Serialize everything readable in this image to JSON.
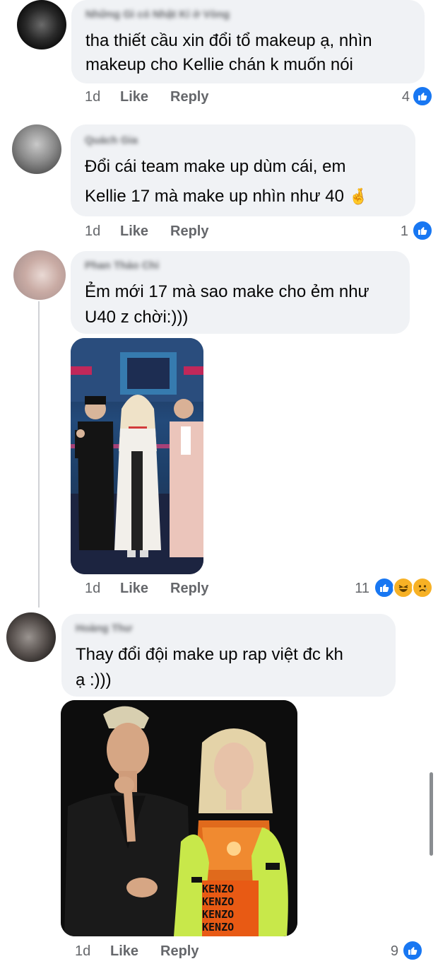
{
  "comments": [
    {
      "author": "Những Gì có Nhật Kí ở Vòng",
      "text_lines": [
        "tha thiết cầu xin đổi tổ makeup ạ, nhìn",
        "makeup cho Kellie chán k muốn nói"
      ],
      "time": "1d",
      "like_label": "Like",
      "reply_label": "Reply",
      "reaction_count": "4",
      "reactions": [
        "like-icon"
      ]
    },
    {
      "author": "Quách Gia",
      "text_lines": [
        "Đổi cái team make up dùm cái, em",
        "Kellie 17 mà make up nhìn như 40"
      ],
      "emoji": "🤞",
      "time": "1d",
      "like_label": "Like",
      "reply_label": "Reply",
      "reaction_count": "1",
      "reactions": [
        "like-icon"
      ]
    },
    {
      "author": "Phan Thảo Chi",
      "text_lines": [
        "Ẻm mới 17 mà sao make cho ẻm như",
        "U40 z chời:)))"
      ],
      "time": "1d",
      "like_label": "Like",
      "reply_label": "Reply",
      "reaction_count": "11",
      "reactions": [
        "like-icon",
        "laughing-face-icon",
        "sad-face-icon"
      ]
    },
    {
      "author": "Hoàng Thư",
      "text_lines": [
        "Thay đổi đội make up rap việt đc kh",
        "ạ :)))"
      ],
      "time": "1d",
      "like_label": "Like",
      "reply_label": "Reply",
      "reaction_count": "9",
      "reactions": [
        "like-icon"
      ]
    }
  ],
  "photo_tiles": [
    "KENZO",
    "KENZO",
    "KENZO",
    "KENZO"
  ],
  "colors": {
    "bubble": "#f0f2f5",
    "meta_text": "#65676b",
    "like_blue": "#1877f2",
    "emoji_yellow": "#f7b125"
  }
}
